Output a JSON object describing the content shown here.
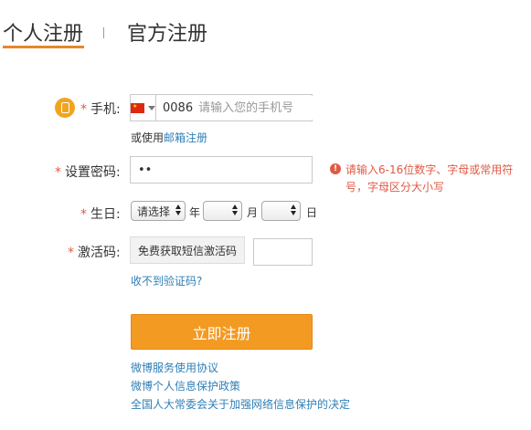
{
  "tabs": {
    "personal": "个人注册",
    "official": "官方注册"
  },
  "form": {
    "phone_label": "手机:",
    "country_code": "0086",
    "phone_placeholder": "请输入您的手机号",
    "alt_prefix": "或使用",
    "alt_link": "邮箱注册",
    "password_label": "设置密码:",
    "password_value": "••",
    "password_error": "请输入6-16位数字、字母或常用符号，字母区分大小写",
    "birthday_label": "生日:",
    "year_select": "请选择",
    "year_unit": "年",
    "month_unit": "月",
    "day_unit": "日",
    "code_label": "激活码:",
    "sms_button": "免费获取短信激活码",
    "no_code_link": "收不到验证码?",
    "submit": "立即注册",
    "required_mark": "*"
  },
  "footer_links": [
    "微博服务使用协议",
    "微博个人信息保护政策",
    "全国人大常委会关于加强网络信息保护的决定"
  ],
  "colors": {
    "accent": "#f39a22",
    "link": "#2f7fb7",
    "error": "#e05a46",
    "tab_underline": "#e8862a"
  },
  "icons": {
    "phone_hint": "mobile-phone-icon",
    "flag": "china-flag-icon",
    "error": "exclamation-icon"
  }
}
